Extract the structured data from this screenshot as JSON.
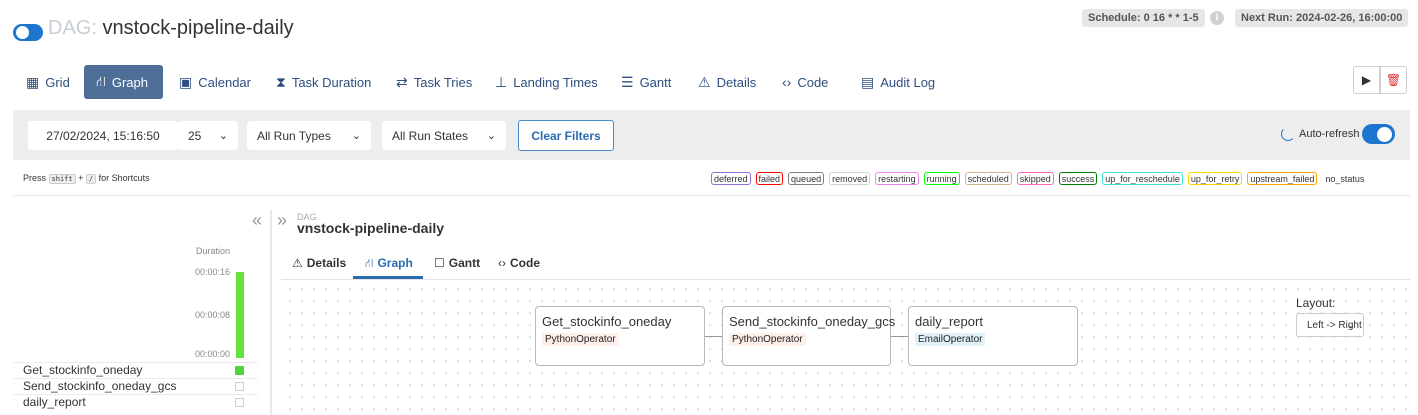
{
  "header": {
    "dag_prefix": "DAG:",
    "dag_id": "vnstock-pipeline-daily",
    "schedule": "Schedule: 0 16 * * 1-5",
    "info": "i",
    "next_run": "Next Run: 2024-02-26, 16:00:00"
  },
  "tabs": [
    {
      "label": "Grid",
      "icon": "grid-icon",
      "glyph": "▦"
    },
    {
      "label": "Graph",
      "icon": "graph-icon",
      "glyph": "⛙"
    },
    {
      "label": "Calendar",
      "icon": "calendar-icon",
      "glyph": "▣"
    },
    {
      "label": "Task Duration",
      "icon": "hourglass-icon",
      "glyph": "⧗"
    },
    {
      "label": "Task Tries",
      "icon": "retry-icon",
      "glyph": "⇄"
    },
    {
      "label": "Landing Times",
      "icon": "landing-icon",
      "glyph": "⊥"
    },
    {
      "label": "Gantt",
      "icon": "gantt-icon",
      "glyph": "☰"
    },
    {
      "label": "Details",
      "icon": "warning-icon",
      "glyph": "⚠"
    },
    {
      "label": "Code",
      "icon": "code-icon",
      "glyph": "‹›"
    },
    {
      "label": "Audit Log",
      "icon": "audit-icon",
      "glyph": "▤"
    }
  ],
  "controls": {
    "play": "▶",
    "delete": "🗑"
  },
  "filters": {
    "date": "27/02/2024, 15:16:50",
    "runs": "25",
    "run_types": "All Run Types",
    "run_states": "All Run States",
    "clear": "Clear Filters",
    "auto_refresh": "Auto-refresh"
  },
  "shortcuts": {
    "press": "Press",
    "shift": "shift",
    "plus": "+",
    "slash": "/",
    "suffix": "for Shortcuts"
  },
  "legend": [
    {
      "label": "deferred",
      "color": "#9370db"
    },
    {
      "label": "failed",
      "color": "#ff0000"
    },
    {
      "label": "queued",
      "color": "#808080"
    },
    {
      "label": "removed",
      "color": "#d3d3d3"
    },
    {
      "label": "restarting",
      "color": "#ee82ee"
    },
    {
      "label": "running",
      "color": "#00ff00"
    },
    {
      "label": "scheduled",
      "color": "#d2b48c"
    },
    {
      "label": "skipped",
      "color": "#ff69b4"
    },
    {
      "label": "success",
      "color": "#008000"
    },
    {
      "label": "up_for_reschedule",
      "color": "#40e0d0"
    },
    {
      "label": "up_for_retry",
      "color": "#ffd700"
    },
    {
      "label": "upstream_failed",
      "color": "#ffa500"
    },
    {
      "label": "no_status",
      "color": "transparent"
    }
  ],
  "grid": {
    "collapse": "«",
    "duration_label": "Duration",
    "ticks": [
      "00:00:16",
      "00:00:08",
      "00:00:00"
    ],
    "tasks": [
      {
        "name": "Get_stockinfo_oneday",
        "state": "success"
      },
      {
        "name": "Send_stockinfo_oneday_gcs",
        "state": "none"
      },
      {
        "name": "daily_report",
        "state": "none"
      }
    ]
  },
  "panel": {
    "expand": "»",
    "dag_small": "DAG",
    "dag_name": "vnstock-pipeline-daily",
    "subtabs": [
      {
        "label": "Details",
        "glyph": "⚠",
        "icon": "warning-icon"
      },
      {
        "label": "Graph",
        "glyph": "⛙",
        "icon": "graph-icon"
      },
      {
        "label": "Gantt",
        "glyph": "☐",
        "icon": "gantt-icon"
      },
      {
        "label": "Code",
        "glyph": "‹›",
        "icon": "code-icon"
      }
    ]
  },
  "graph": {
    "nodes": [
      {
        "label": "Get_stockinfo_oneday",
        "operator": "PythonOperator",
        "op_color": "#ffefeb"
      },
      {
        "label": "Send_stockinfo_oneday_gcs",
        "operator": "PythonOperator",
        "op_color": "#ffefeb"
      },
      {
        "label": "daily_report",
        "operator": "EmailOperator",
        "op_color": "#e0f1f7"
      }
    ],
    "layout_label": "Layout:",
    "layout_value": "Left -> Right"
  }
}
